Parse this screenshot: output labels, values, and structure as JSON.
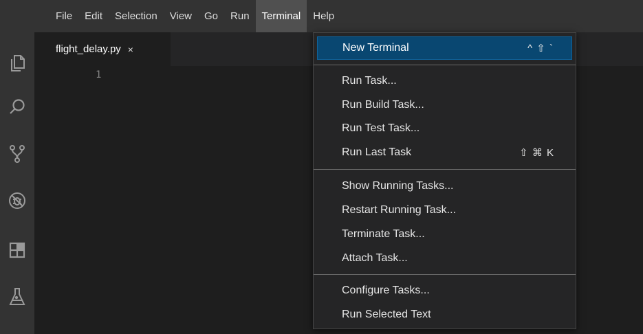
{
  "menubar": {
    "items": [
      {
        "label": "File"
      },
      {
        "label": "Edit"
      },
      {
        "label": "Selection"
      },
      {
        "label": "View"
      },
      {
        "label": "Go"
      },
      {
        "label": "Run"
      },
      {
        "label": "Terminal"
      },
      {
        "label": "Help"
      }
    ],
    "active": "Terminal"
  },
  "activitybar": {
    "icons": [
      "files-icon",
      "search-icon",
      "source-control-icon",
      "debug-icon",
      "extensions-icon",
      "testing-icon"
    ]
  },
  "editor": {
    "tab": {
      "title": "flight_delay.py",
      "close": "×"
    },
    "line_numbers": [
      "1"
    ]
  },
  "terminal_menu": {
    "items": [
      {
        "label": "New Terminal",
        "shortcut": "^ ⇧ `",
        "selected": true
      },
      {
        "label": "Run Task...",
        "shortcut": ""
      },
      {
        "label": "Run Build Task...",
        "shortcut": ""
      },
      {
        "label": "Run Test Task...",
        "shortcut": ""
      },
      {
        "label": "Run Last Task",
        "shortcut": "⇧ ⌘ K"
      },
      {
        "label": "Show Running Tasks...",
        "shortcut": ""
      },
      {
        "label": "Restart Running Task...",
        "shortcut": ""
      },
      {
        "label": "Terminate Task...",
        "shortcut": ""
      },
      {
        "label": "Attach Task...",
        "shortcut": ""
      },
      {
        "label": "Configure Tasks...",
        "shortcut": ""
      },
      {
        "label": "Run Selected Text",
        "shortcut": ""
      }
    ]
  },
  "colors": {
    "menubar_bg": "#333333",
    "editor_bg": "#1e1e1e",
    "selection": "#094771"
  }
}
